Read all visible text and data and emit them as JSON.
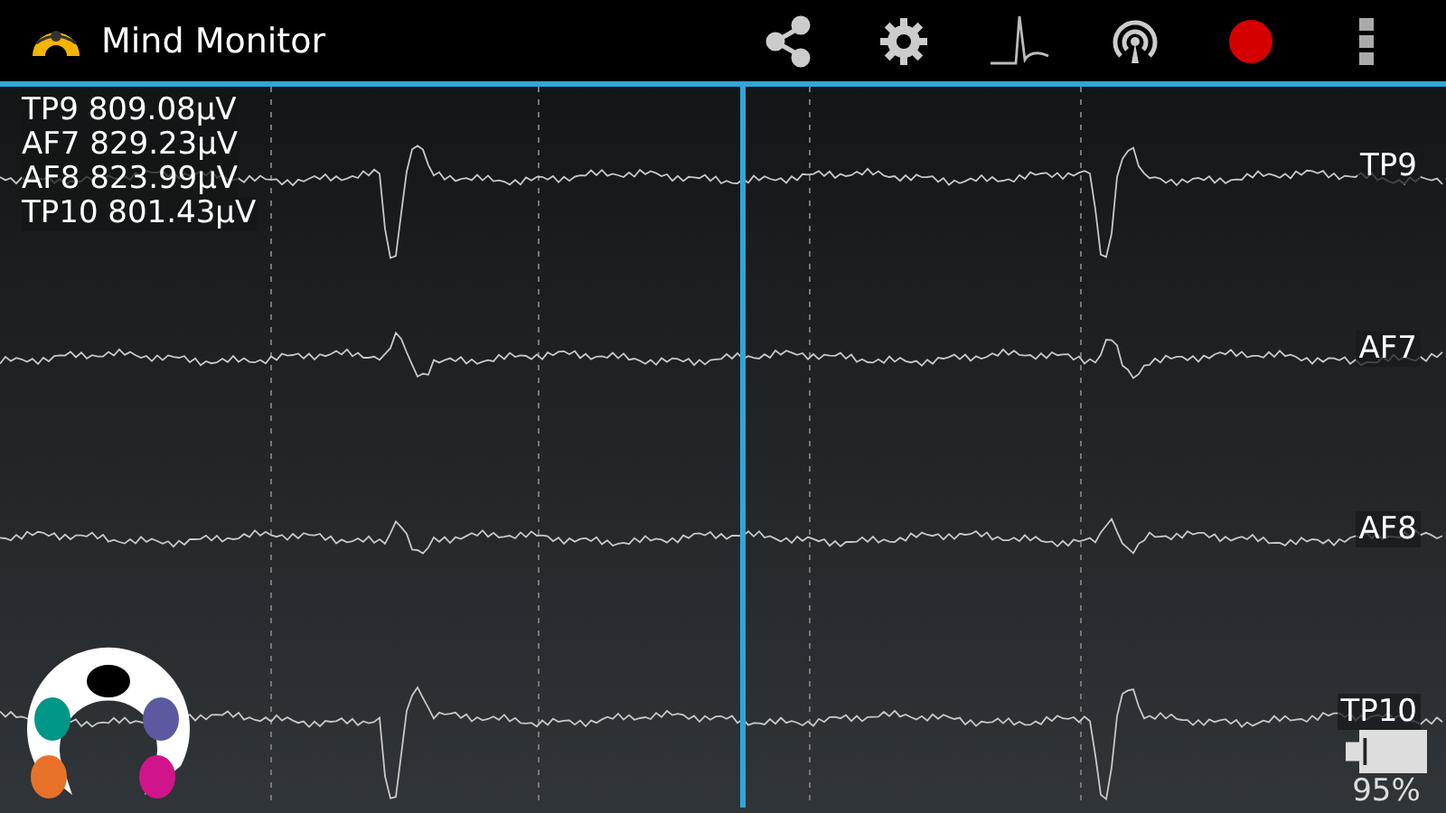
{
  "app_bar": {
    "title": "Mind Monitor"
  },
  "readings": [
    "TP9 809.08µV",
    "AF7 829.23µV",
    "AF8 823.99µV",
    "TP10 801.43µV"
  ],
  "channels": [
    {
      "label": "TP9",
      "kind": "temporal"
    },
    {
      "label": "AF7",
      "kind": "frontal"
    },
    {
      "label": "AF8",
      "kind": "frontal"
    },
    {
      "label": "TP10",
      "kind": "temporal"
    }
  ],
  "sensors": [
    {
      "color": "#000000"
    },
    {
      "color": "#5b5aa0"
    },
    {
      "color": "#d0158a"
    },
    {
      "color": "#e8712a"
    },
    {
      "color": "#009688"
    }
  ],
  "battery": {
    "reading": "95%"
  }
}
